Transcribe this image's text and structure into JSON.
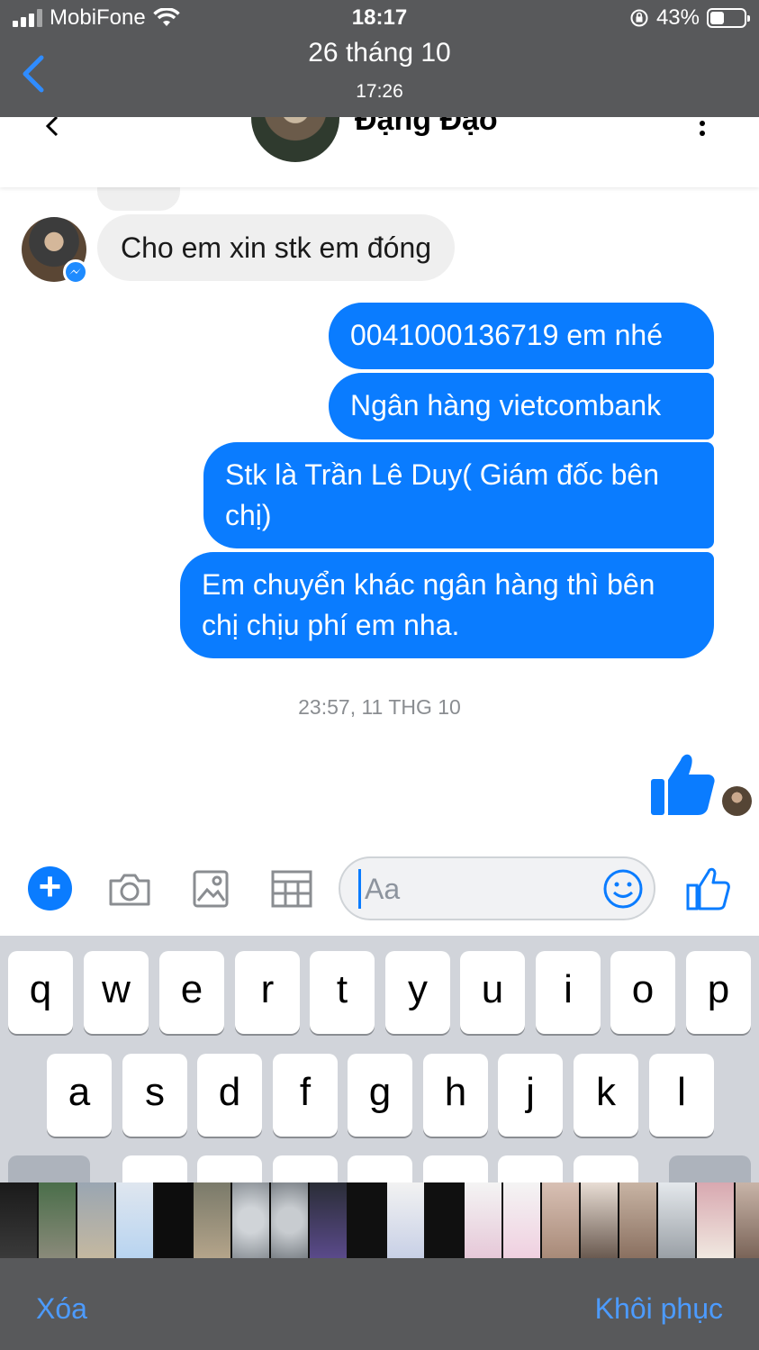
{
  "status_bar": {
    "carrier": "MobiFone",
    "time": "18:17",
    "battery": "43%",
    "battery_level": 0.43
  },
  "viewer": {
    "date": "26 tháng 10",
    "time": "17:26",
    "back_icon": "chevron-left-icon"
  },
  "chat": {
    "contact_name": "Đặng Đạo",
    "incoming": [
      {
        "text": "Cho em xin stk em đóng"
      }
    ],
    "outgoing": [
      {
        "text": "0041000136719 em nhé"
      },
      {
        "text": "Ngân hàng vietcombank"
      },
      {
        "text": "Stk là Trần Lê Duy( Giám đốc bên chị)"
      },
      {
        "text": "Em chuyển khác ngân hàng thì bên chị chịu phí em nha."
      }
    ],
    "timestamp": "23:57, 11 THG 10"
  },
  "composer": {
    "placeholder": "Aa",
    "plus_label": "+"
  },
  "keyboard": {
    "row1": [
      "q",
      "w",
      "e",
      "r",
      "t",
      "y",
      "u",
      "i",
      "o",
      "p"
    ],
    "row2": [
      "a",
      "s",
      "d",
      "f",
      "g",
      "h",
      "j",
      "k",
      "l"
    ]
  },
  "bottom_bar": {
    "delete_label": "Xóa",
    "restore_label": "Khôi phục"
  },
  "colors": {
    "messenger_blue": "#0a7cff",
    "ios_link_blue": "#4c9bff",
    "overlay_grey": "#58595b",
    "incoming_bubble": "#efefef"
  }
}
